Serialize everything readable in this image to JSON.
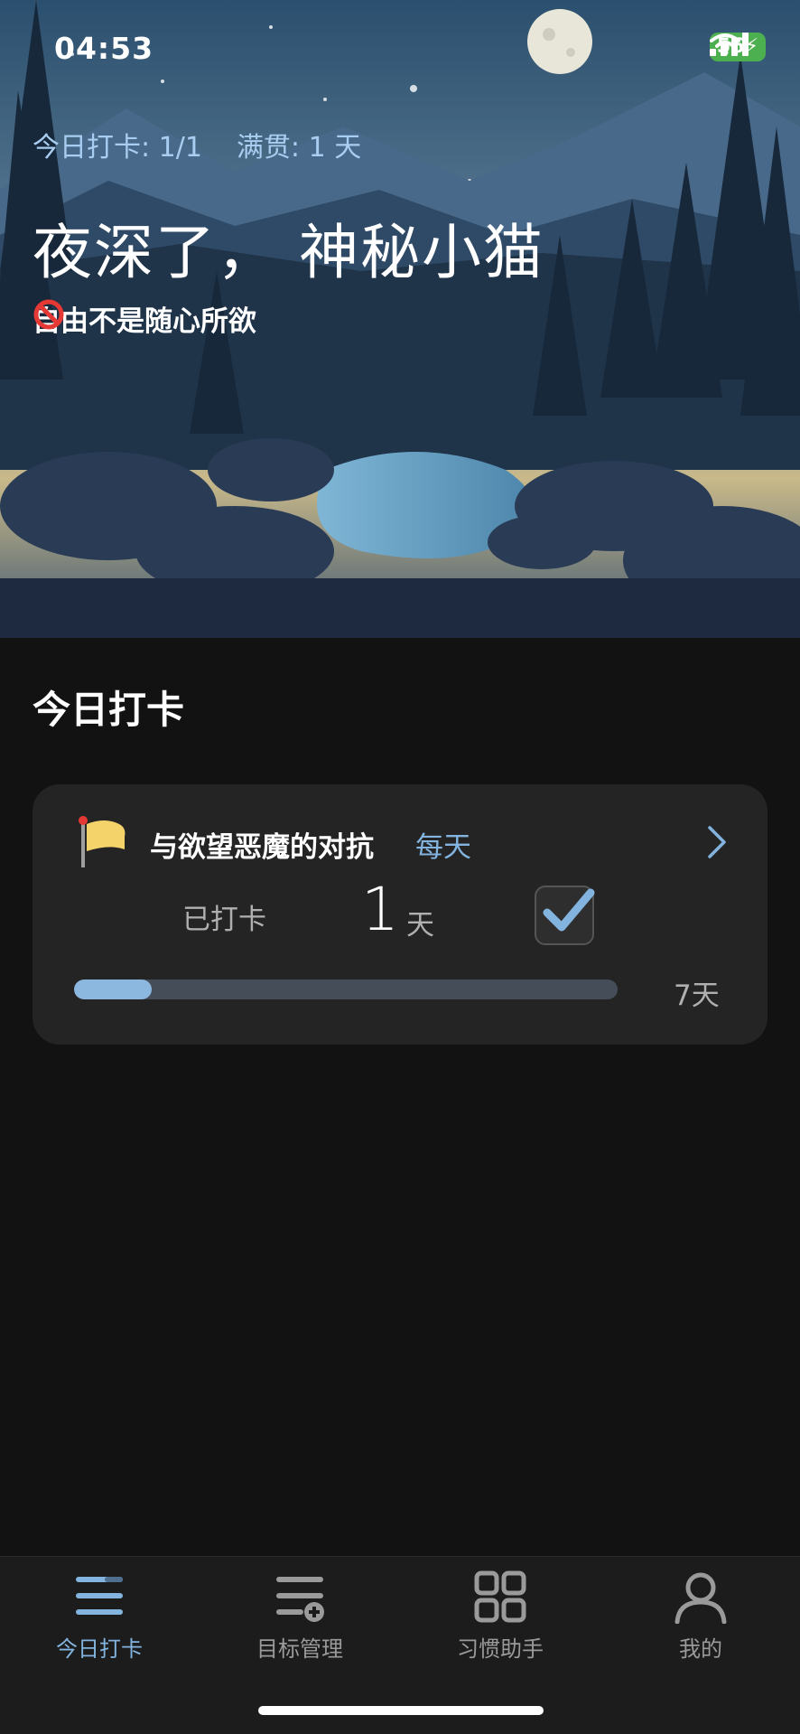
{
  "status_bar": {
    "time": "04:53",
    "battery": "56"
  },
  "header": {
    "checkin_stat": "今日打卡: 1/1",
    "streak_stat": "满贯: 1 天",
    "greeting": "夜深了， 神秘小猫",
    "motto": "自由不是随心所欲",
    "motto_icon": "prohibited-icon"
  },
  "section": {
    "title": "今日打卡"
  },
  "habit_card": {
    "title": "与欲望恶魔的对抗",
    "frequency": "每天",
    "done_label": "已打卡",
    "done_count": "1",
    "done_unit": "天",
    "checked": true,
    "progress_fraction": 0.143,
    "goal_label": "7天"
  },
  "tabbar": {
    "items": [
      {
        "label": "今日打卡",
        "icon": "list-icon",
        "active": true
      },
      {
        "label": "目标管理",
        "icon": "list-add-icon",
        "active": false
      },
      {
        "label": "习惯助手",
        "icon": "grid-icon",
        "active": false
      },
      {
        "label": "我的",
        "icon": "person-icon",
        "active": false
      }
    ]
  },
  "colors": {
    "accent": "#82b4df",
    "background": "#121212",
    "card": "#242424"
  }
}
